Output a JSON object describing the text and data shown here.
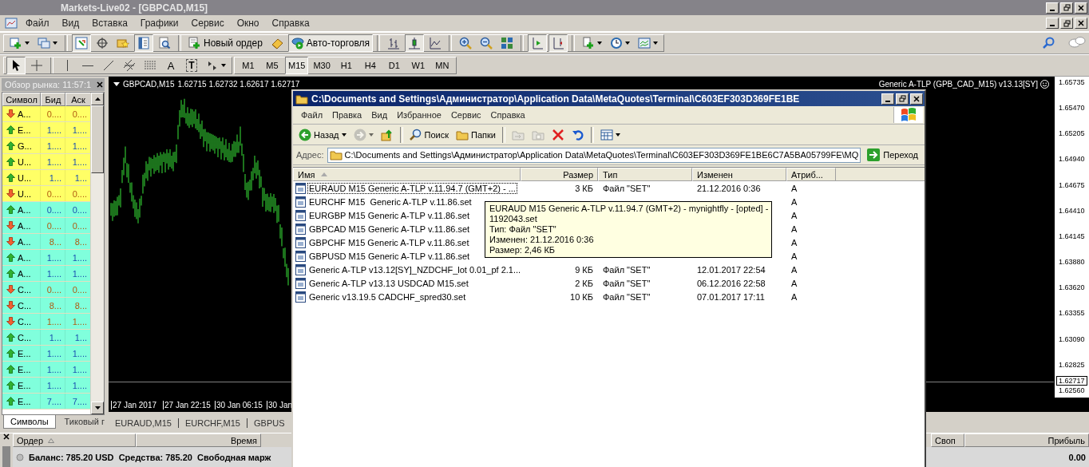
{
  "window": {
    "title": "Markets-Live02 - [GBPCAD,M15]"
  },
  "menu": [
    "Файл",
    "Вид",
    "Вставка",
    "Графики",
    "Сервис",
    "Окно",
    "Справка"
  ],
  "toolbar": [
    {
      "kind": "new-chart",
      "pressed": false
    },
    {
      "kind": "profiles",
      "pressed": false
    },
    {
      "kind": "separator"
    },
    {
      "kind": "market-watch",
      "pressed": true
    },
    {
      "kind": "data-window",
      "pressed": false
    },
    {
      "kind": "favorites",
      "pressed": false
    },
    {
      "kind": "terminal",
      "pressed": true
    },
    {
      "kind": "tester",
      "pressed": false
    },
    {
      "kind": "separator"
    },
    {
      "kind": "new-order",
      "label": "Новый ордер",
      "pressed": false
    },
    {
      "kind": "editor",
      "pressed": false
    },
    {
      "kind": "autotrading",
      "label": "Авто-торговля",
      "pressed": true
    },
    {
      "kind": "separator"
    },
    {
      "kind": "bar-chart",
      "pressed": false
    },
    {
      "kind": "candles",
      "pressed": true
    },
    {
      "kind": "line-chart",
      "pressed": false
    },
    {
      "kind": "separator"
    },
    {
      "kind": "zoom-in",
      "pressed": false
    },
    {
      "kind": "zoom-out",
      "pressed": false
    },
    {
      "kind": "tile",
      "pressed": false
    },
    {
      "kind": "separator"
    },
    {
      "kind": "autoscroll",
      "pressed": true
    },
    {
      "kind": "shift",
      "pressed": true
    },
    {
      "kind": "separator"
    },
    {
      "kind": "indicators",
      "pressed": false
    },
    {
      "kind": "periods",
      "pressed": false
    },
    {
      "kind": "templates",
      "pressed": false
    }
  ],
  "drawing_tools": [
    {
      "kind": "cursor",
      "pressed": true
    },
    {
      "kind": "crosshair",
      "pressed": false
    },
    {
      "kind": "separator"
    },
    {
      "kind": "vline",
      "pressed": false
    },
    {
      "kind": "hline",
      "pressed": false
    },
    {
      "kind": "trendline",
      "pressed": false
    },
    {
      "kind": "channel",
      "pressed": false
    },
    {
      "kind": "fibo",
      "pressed": false
    },
    {
      "kind": "text",
      "label": "A",
      "pressed": false
    },
    {
      "kind": "label",
      "label": "T",
      "pressed": false
    },
    {
      "kind": "arrows",
      "pressed": false
    }
  ],
  "timeframes": [
    {
      "label": "M1",
      "selected": false
    },
    {
      "label": "M5",
      "selected": false
    },
    {
      "label": "M15",
      "selected": true
    },
    {
      "label": "M30",
      "selected": false
    },
    {
      "label": "H1",
      "selected": false
    },
    {
      "label": "H4",
      "selected": false
    },
    {
      "label": "D1",
      "selected": false
    },
    {
      "label": "W1",
      "selected": false
    },
    {
      "label": "MN",
      "selected": false
    }
  ],
  "market_watch": {
    "title": "Обзор рынка: 11:57:1",
    "columns": [
      "Символ",
      "Бид",
      "Аск"
    ],
    "rows": [
      {
        "rising": false,
        "symbol": "A...",
        "bid": "0....",
        "ask": "0....",
        "color": "#ffff66"
      },
      {
        "rising": true,
        "symbol": "E...",
        "bid": "1....",
        "ask": "1....",
        "color": "#ffff66"
      },
      {
        "rising": true,
        "symbol": "G...",
        "bid": "1....",
        "ask": "1....",
        "color": "#ffff66"
      },
      {
        "rising": true,
        "symbol": "U...",
        "bid": "1....",
        "ask": "1....",
        "color": "#ffff66"
      },
      {
        "rising": true,
        "symbol": "U...",
        "bid": "1...",
        "ask": "1...",
        "color": "#ffff66"
      },
      {
        "rising": false,
        "symbol": "U...",
        "bid": "0....",
        "ask": "0....",
        "color": "#ffff66"
      },
      {
        "rising": true,
        "symbol": "A...",
        "bid": "0....",
        "ask": "0....",
        "color": "#80ffdc"
      },
      {
        "rising": false,
        "symbol": "A...",
        "bid": "0....",
        "ask": "0....",
        "color": "#80ffdc"
      },
      {
        "rising": false,
        "symbol": "A...",
        "bid": "8...",
        "ask": "8...",
        "color": "#80ffdc"
      },
      {
        "rising": true,
        "symbol": "A...",
        "bid": "1....",
        "ask": "1....",
        "color": "#80ffdc"
      },
      {
        "rising": true,
        "symbol": "A...",
        "bid": "1....",
        "ask": "1....",
        "color": "#80ffdc"
      },
      {
        "rising": false,
        "symbol": "C...",
        "bid": "0....",
        "ask": "0....",
        "color": "#80ffdc"
      },
      {
        "rising": false,
        "symbol": "C...",
        "bid": "8...",
        "ask": "8...",
        "color": "#80ffdc"
      },
      {
        "rising": false,
        "symbol": "C...",
        "bid": "1....",
        "ask": "1....",
        "color": "#80ffdc"
      },
      {
        "rising": true,
        "symbol": "C...",
        "bid": "1...",
        "ask": "1...",
        "color": "#80ffdc"
      },
      {
        "rising": true,
        "symbol": "E...",
        "bid": "1....",
        "ask": "1....",
        "color": "#80ffdc"
      },
      {
        "rising": true,
        "symbol": "E...",
        "bid": "1....",
        "ask": "1....",
        "color": "#80ffdc"
      },
      {
        "rising": true,
        "symbol": "E...",
        "bid": "1....",
        "ask": "1....",
        "color": "#80ffdc"
      },
      {
        "rising": true,
        "symbol": "E...",
        "bid": "7....",
        "ask": "7....",
        "color": "#80ffdc"
      }
    ],
    "tabs": [
      {
        "label": "Символы",
        "selected": true
      },
      {
        "label": "Тиковый г",
        "selected": false
      }
    ]
  },
  "chart": {
    "symbol": "GBPCAD,M15",
    "quotes": "1.62715 1.62732 1.62617 1.62717",
    "expert": "Generic A-TLP (GPB_CAD_M15) v13.13[SY]",
    "price_labels": [
      "1.65735",
      "1.65470",
      "1.65205",
      "1.64940",
      "1.64675",
      "1.64410",
      "1.64145",
      "1.63880",
      "1.63620",
      "1.63355",
      "1.63090",
      "1.62825",
      "1.62560"
    ],
    "current_price": "1.62717",
    "time_labels": [
      "27 Jan 2017",
      "27 Jan 22:15",
      "30 Jan 06:15",
      "30 Jan"
    ],
    "tabs": [
      "EURAUD,M15",
      "EURCHF,M15",
      "GBPUS"
    ]
  },
  "terminal": {
    "columns_left": [
      "Ордер",
      "Время"
    ],
    "columns_right": [
      "Своп",
      "Прибыль"
    ],
    "balance": "Баланс: 785.20 USD  Средства: 785.20  Свободная марж",
    "profit": "0.00"
  },
  "explorer": {
    "title": "C:\\Documents and Settings\\Администратор\\Application Data\\MetaQuotes\\Terminal\\C603EF303D369FE1BE",
    "menu": [
      "Файл",
      "Правка",
      "Вид",
      "Избранное",
      "Сервис",
      "Справка"
    ],
    "toolbar": [
      {
        "kind": "back",
        "label": "Назад",
        "disabled": false
      },
      {
        "kind": "forward",
        "disabled": true
      },
      {
        "kind": "up",
        "disabled": false
      },
      {
        "kind": "separator"
      },
      {
        "kind": "search",
        "label": "Поиск",
        "disabled": false
      },
      {
        "kind": "folders",
        "label": "Папки",
        "disabled": false
      },
      {
        "kind": "separator"
      },
      {
        "kind": "move",
        "disabled": true
      },
      {
        "kind": "copy",
        "disabled": true
      },
      {
        "kind": "delete",
        "disabled": false
      },
      {
        "kind": "undo",
        "disabled": false
      },
      {
        "kind": "separator"
      },
      {
        "kind": "views",
        "disabled": false
      }
    ],
    "address": {
      "label": "Адрес:",
      "value": "C:\\Documents and Settings\\Администратор\\Application Data\\MetaQuotes\\Terminal\\C603EF303D369FE1BE6C7A5BA05799FE\\MQ",
      "go": "Переход"
    },
    "columns": [
      "Имя",
      "Размер",
      "Тип",
      "Изменен",
      "Атриб..."
    ],
    "files": [
      {
        "name": "EURAUD M15 Generic A-TLP v.11.94.7 (GMT+2) - ...",
        "size": "3 КБ",
        "type": "Файл \"SET\"",
        "modified": "21.12.2016 0:36",
        "attributes": "A",
        "selected": true
      },
      {
        "name": "EURCHF M15  Generic A-TLP v.11.86.set",
        "attributes": "A",
        "selected": false
      },
      {
        "name": "EURGBP M15 Generic A-TLP v.11.86.set",
        "attributes": "A",
        "selected": false
      },
      {
        "name": "GBPCAD M15 Generic A-TLP v.11.86.set",
        "attributes": "A",
        "selected": false
      },
      {
        "name": "GBPCHF M15 Generic A-TLP v.11.86.set",
        "attributes": "A",
        "selected": false
      },
      {
        "name": "GBPUSD M15 Generic A-TLP v.11.86.set",
        "attributes": "A",
        "selected": false
      },
      {
        "name": "Generic A-TLP v13.12[SY]_NZDCHF_lot 0.01_pf 2.1...",
        "size": "9 КБ",
        "type": "Файл \"SET\"",
        "modified": "12.01.2017 22:54",
        "attributes": "A",
        "selected": false
      },
      {
        "name": "Generic A-TLP v13.13 USDCAD M15.set",
        "size": "2 КБ",
        "type": "Файл \"SET\"",
        "modified": "06.12.2016 22:58",
        "attributes": "A",
        "selected": false
      },
      {
        "name": "Generic v13.19.5 CADCHF_spred30.set",
        "size": "10 КБ",
        "type": "Файл \"SET\"",
        "modified": "07.01.2017 17:11",
        "attributes": "A",
        "selected": false
      }
    ],
    "tooltip": [
      "EURAUD M15 Generic A-TLP v.11.94.7 (GMT+2) - mynightfly - [opted] -",
      "1192043.set",
      "Тип: Файл \"SET\"",
      "Изменен: 21.12.2016 0:36",
      "Размер: 2,46 КБ"
    ]
  }
}
